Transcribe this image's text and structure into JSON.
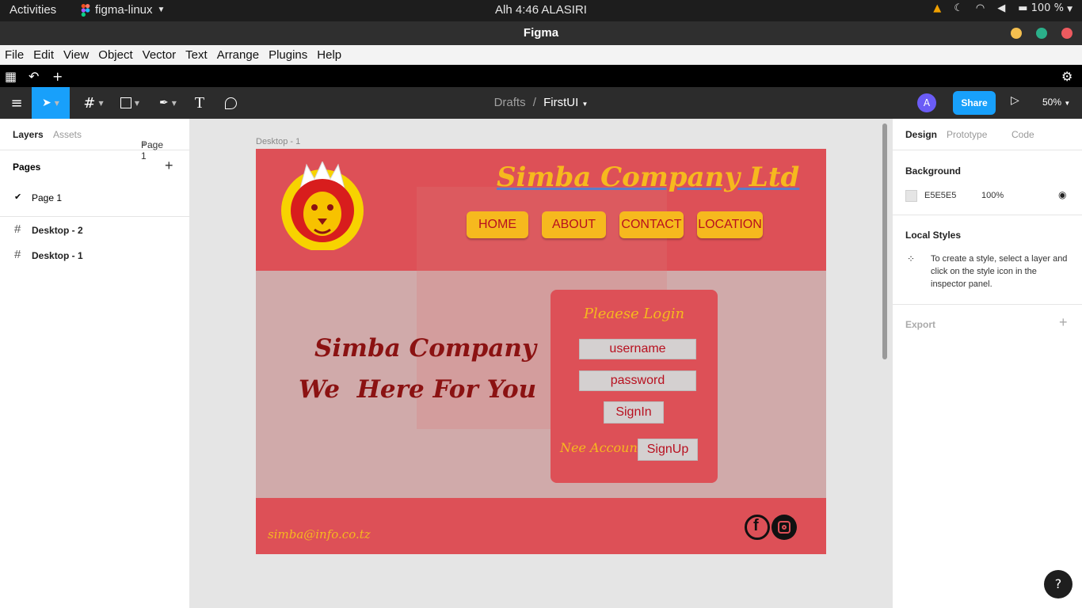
{
  "system": {
    "activities": "Activities",
    "app_name": "figma-linux",
    "clock": "Alh  4:46 ALASIRI",
    "battery": "100 %"
  },
  "window": {
    "title": "Figma"
  },
  "menu": [
    "File",
    "Edit",
    "View",
    "Object",
    "Vector",
    "Text",
    "Arrange",
    "Plugins",
    "Help"
  ],
  "toolbar": {
    "breadcrumb_root": "Drafts",
    "breadcrumb_sep": "/",
    "file_name": "FirstUI",
    "avatar": "A",
    "share": "Share",
    "zoom": "50%"
  },
  "left_panel": {
    "tab_layers": "Layers",
    "tab_assets": "Assets",
    "page_select": "Page 1",
    "pages_heading": "Pages",
    "pages": [
      "Page 1"
    ],
    "layers": [
      "Desktop - 2",
      "Desktop - 1"
    ]
  },
  "canvas": {
    "frame_label": "Desktop - 1",
    "site_title": "Simba Company Ltd",
    "nav": [
      "HOME",
      "ABOUT",
      "CONTACT",
      "LOCATION"
    ],
    "hero_line1": "Simba Company",
    "hero_line2": "We  Here For You",
    "login_title": "Pleaese Login",
    "username": "username",
    "password": "password",
    "signin": "SignIn",
    "need_account": "Nee Account?",
    "signup": "SignUp",
    "email": "simba@info.co.tz"
  },
  "right_panel": {
    "tab_design": "Design",
    "tab_prototype": "Prototype",
    "tab_code": "Code",
    "background_heading": "Background",
    "bg_hex": "E5E5E5",
    "bg_opacity": "100%",
    "local_styles_heading": "Local Styles",
    "local_styles_text": "To create a style, select a layer and click on the style icon in the inspector panel.",
    "export_heading": "Export"
  },
  "help": "?",
  "colors": {
    "accent": "#18a0fb",
    "brand_red": "#dd5057",
    "brand_yellow": "#f6b91e",
    "dark_red": "#8b1212"
  }
}
